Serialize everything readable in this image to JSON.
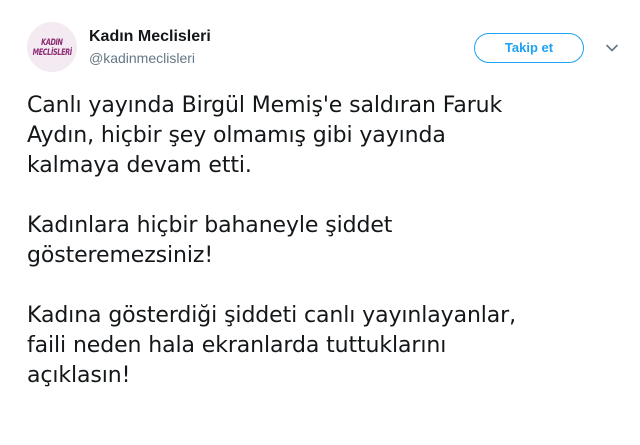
{
  "account": {
    "display_name": "Kadın Meclisleri",
    "handle": "@kadinmeclisleri",
    "avatar_logo": {
      "line1": "KADIN",
      "line2": "MECLİSLERİ"
    }
  },
  "actions": {
    "follow_label": "Takip et",
    "more_icon": "chevron-down-icon"
  },
  "tweet": {
    "paragraphs": [
      {
        "lines": [
          "Canlı yayında Birgül Memiş'e saldıran Faruk",
          "Aydın, hiçbir şey olmamış gibi yayında",
          "kalmaya devam etti."
        ]
      },
      {
        "lines": [
          "Kadınlara hiçbir bahaneyle şiddet",
          "gösteremezsiniz!"
        ]
      },
      {
        "lines": [
          "Kadına gösterdiği şiddeti canlı yayınlayanlar,",
          "faili neden hala ekranlarda tuttuklarını",
          "açıklasın!"
        ]
      }
    ]
  },
  "colors": {
    "accent": "#1da1f2",
    "text": "#14171a",
    "secondary_text": "#657786",
    "chevron": "#657786",
    "avatar_logo": "#8c2b74",
    "avatar_bg": "#f4eaf1"
  }
}
